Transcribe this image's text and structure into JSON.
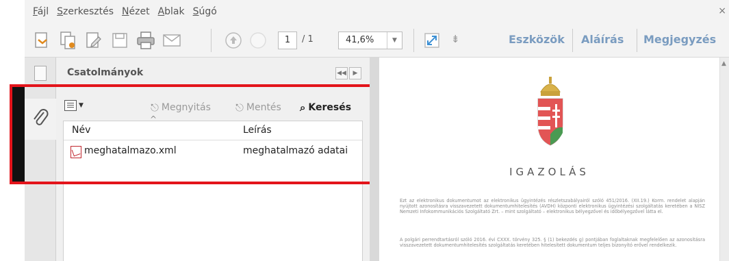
{
  "menu": {
    "items": [
      "Fájl",
      "Szerkesztés",
      "Nézet",
      "Ablak",
      "Súgó"
    ],
    "close": "×"
  },
  "toolbar": {
    "page_current": "1",
    "page_total": "/ 1",
    "zoom": "41,6%",
    "links": [
      "Eszközök",
      "Aláírás",
      "Megjegyzés"
    ]
  },
  "panel": {
    "title": "Csatolmányok",
    "actions": {
      "open": "Megnyitás",
      "save": "Mentés",
      "search": "Keresés"
    },
    "columns": {
      "name": "Név",
      "description": "Leírás"
    },
    "rows": [
      {
        "name": "meghatalmazo.xml",
        "description": "meghatalmazó adatai"
      }
    ]
  },
  "document": {
    "heading": "IGAZOLÁS",
    "paragraph1": "Ezt az elektronikus dokumentumot az elektronikus ügyintézés részletszabályairól szóló 451/2016. (XII.19.) Korm. rendelet alapján nyújtott azonosításra visszavezetett dokumentumhitelesítés (AVDH) központi elektronikus ügyintézési szolgáltatás keretében a NISZ Nemzeti Infokommunikációs Szolgáltató Zrt. – mint szolgáltató – elektronikus bélyegzővel és időbélyegzővel látta el.",
    "paragraph2": "A polgári perrendtartásról szóló 2016. évi CXXX. törvény 325. § (1) bekezdés g) pontjában foglaltaknak megfelelően az azonosításra visszavezetett dokumentumhitelesítés szolgáltatás keretében hitelesített dokumentum teljes bizonyító erővel rendelkezik."
  },
  "colors": {
    "highlight": "#e3141b",
    "link": "#7a9cc0",
    "pdf_icon": "#c0262d"
  }
}
